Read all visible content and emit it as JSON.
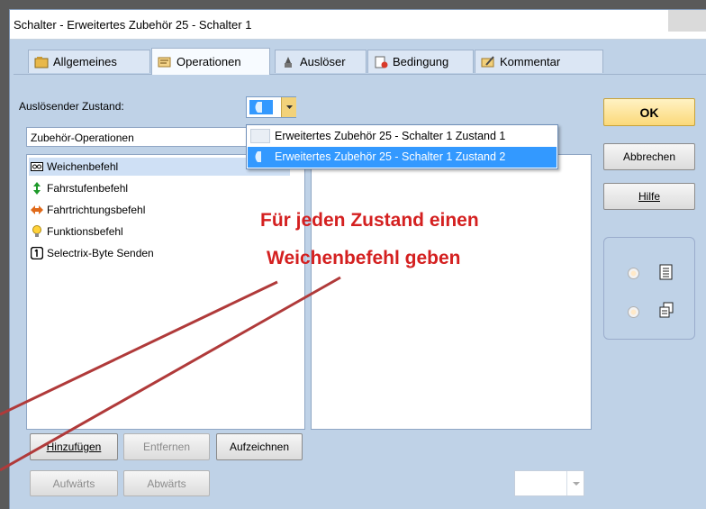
{
  "window": {
    "title": "Schalter - Erweitertes Zubehör 25 - Schalter 1"
  },
  "tabs": [
    {
      "label": "Allgemeines",
      "icon": "settings-icon",
      "active": false
    },
    {
      "label": "Operationen",
      "icon": "operations-icon",
      "active": true
    },
    {
      "label": "Auslöser",
      "icon": "trigger-icon",
      "active": false
    },
    {
      "label": "Bedingung",
      "icon": "condition-icon",
      "active": false
    },
    {
      "label": "Kommentar",
      "icon": "comment-icon",
      "active": false
    }
  ],
  "trigger_state": {
    "label": "Auslösender Zustand:",
    "options": [
      "Erweitertes Zubehör 25 - Schalter 1 Zustand 1",
      "Erweitertes Zubehör 25 - Schalter 1 Zustand 2"
    ],
    "selected_index": 1
  },
  "operations_category": {
    "value": "Zubehör-Operationen"
  },
  "operations_list": [
    {
      "label": "Weichenbefehl",
      "icon": "turnout-icon",
      "selected": true
    },
    {
      "label": "Fahrstufenbefehl",
      "icon": "speed-step-icon",
      "selected": false
    },
    {
      "label": "Fahrtrichtungsbefehl",
      "icon": "direction-icon",
      "selected": false
    },
    {
      "label": "Funktionsbefehl",
      "icon": "lightbulb-icon",
      "selected": false
    },
    {
      "label": "Selectrix-Byte Senden",
      "icon": "selectrix-icon",
      "selected": false
    }
  ],
  "annotation": {
    "line1": "Für jeden Zustand einen",
    "line2": "Weichenbefehl geben",
    "color": "#d42020"
  },
  "buttons": {
    "add": "Hinzufügen",
    "remove": "Entfernen",
    "record": "Aufzeichnen",
    "up": "Aufwärts",
    "down": "Abwärts",
    "ok": "OK",
    "cancel": "Abbrechen",
    "help": "Hilfe"
  },
  "colors": {
    "dialog_bg": "#bfd2e7",
    "selection": "#3399ff",
    "ok_button": "#fde7a0"
  }
}
